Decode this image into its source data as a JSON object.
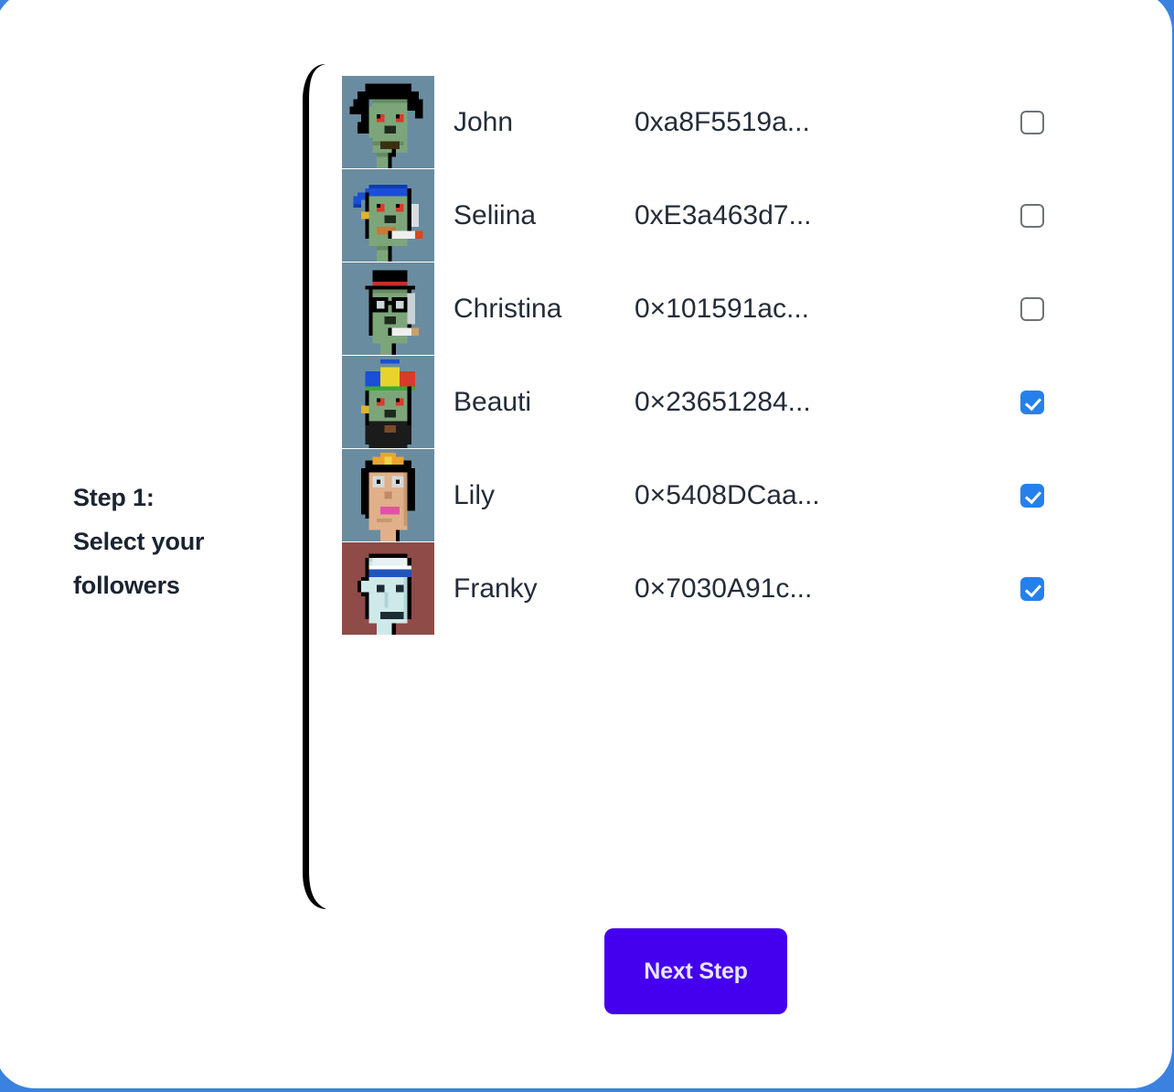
{
  "theme": {
    "page_background": "#3b82e0",
    "card_background": "#ffffff",
    "text_color": "#242c38",
    "heading_color": "#1b2430",
    "checkbox_checked_color": "#2680eb",
    "checkbox_border_color": "#6f7275",
    "button_color": "#4400ee",
    "button_text_color": "#e8e4fb"
  },
  "step": {
    "label_line1": "Step 1:",
    "label_line2": "Select your",
    "label_line3": "followers"
  },
  "followers": [
    {
      "name": "John",
      "address": "0xa8F5519a...",
      "selected": false,
      "avatar": "cryptopunk-zombie-wild-hair"
    },
    {
      "name": "Seliina",
      "address": "0xE3a463d7...",
      "selected": false,
      "avatar": "cryptopunk-zombie-bandana-cigarette"
    },
    {
      "name": "Christina",
      "address": "0×101591ac...",
      "selected": false,
      "avatar": "cryptopunk-zombie-tophat-glasses-cigarette"
    },
    {
      "name": "Beauti",
      "address": "0×23651284...",
      "selected": true,
      "avatar": "cryptopunk-zombie-rainbow-beanie-beard"
    },
    {
      "name": "Lily",
      "address": "0×5408DCaa...",
      "selected": true,
      "avatar": "cryptopunk-female-gold-headband"
    },
    {
      "name": "Franky",
      "address": "0×7030A91c...",
      "selected": true,
      "avatar": "cryptopunk-ape-blue-headband"
    }
  ],
  "actions": {
    "next_step_label": "Next Step"
  }
}
